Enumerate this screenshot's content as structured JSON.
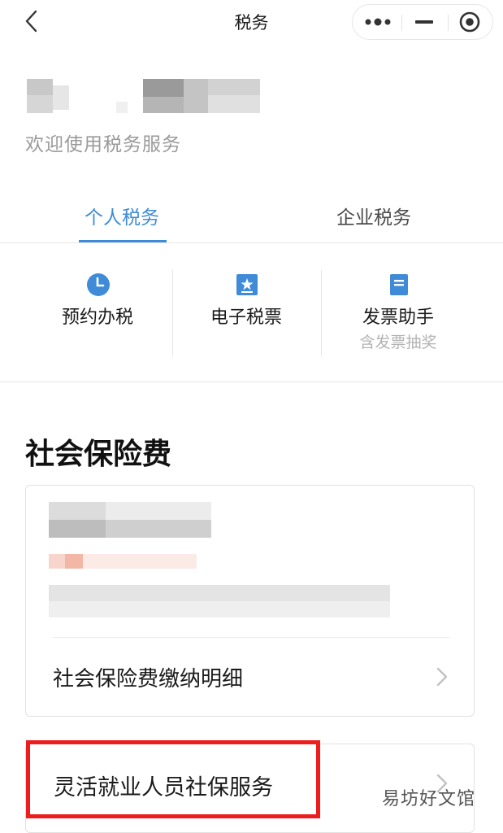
{
  "nav": {
    "title": "税务",
    "back_icon": "chevron-left-icon",
    "more_icon": "more-dots-icon",
    "minimize_icon": "minimize-icon",
    "close_icon": "target-circle-icon"
  },
  "header": {
    "welcome": "欢迎使用税务服务"
  },
  "tabs": [
    {
      "label": "个人税务",
      "active": true
    },
    {
      "label": "企业税务",
      "active": false
    }
  ],
  "shortcuts": [
    {
      "label": "预约办税",
      "sub": "",
      "icon": "clock-icon"
    },
    {
      "label": "电子税票",
      "sub": "",
      "icon": "ticket-star-icon"
    },
    {
      "label": "发票助手",
      "sub": "含发票抽奖",
      "icon": "document-icon"
    }
  ],
  "social_insurance": {
    "title": "社会保险费",
    "detail_link": "社会保险费缴纳明细",
    "flexible_service": "灵活就业人员社保服务"
  },
  "watermark": "易坊好文馆",
  "colors": {
    "accent": "#3f8bd8",
    "highlight": "#ee1c1c",
    "muted_text": "#9a9a9a"
  }
}
